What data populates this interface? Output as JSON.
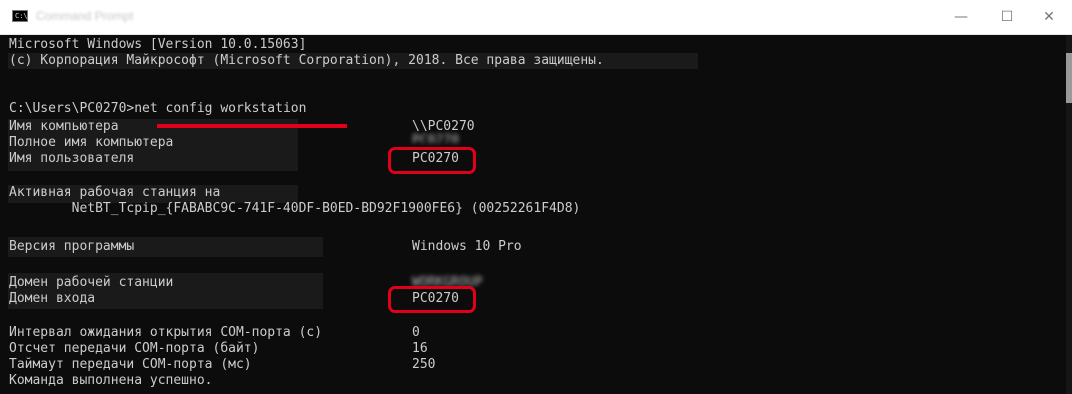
{
  "window": {
    "title": "Command Prompt",
    "icon_label": "C:\\",
    "minimize_glyph": "—",
    "maximize_glyph": "☐",
    "close_glyph": "✕"
  },
  "console": {
    "header_line1": "Microsoft Windows [Version 10.0.15063]",
    "header_line2": "(c) Корпорация Майкрософт (Microsoft Corporation), 2018. Все права защищены.",
    "prompt": "C:\\Users\\PC0270>",
    "command": "net config workstation",
    "rows": {
      "computer_name": {
        "label": "Имя компьютера",
        "value": "\\\\PC0270"
      },
      "full_computer_name": {
        "label": "Полное имя компьютера",
        "value": "PC0270"
      },
      "user_name": {
        "label": "Имя пользователя",
        "value": "PC0270"
      },
      "active_workstation": {
        "label": "Активная рабочая станция на"
      },
      "netbt_line": {
        "text": "        NetBT_Tcpip_{FABABC9C-741F-40DF-B0ED-BD92F1900FE6} (00252261F4D8)"
      },
      "software_version": {
        "label": "Версия программы",
        "value": "Windows 10 Pro"
      },
      "workstation_domain": {
        "label": "Домен рабочей станции",
        "value": "WORKGROUP"
      },
      "logon_domain": {
        "label": "Домен входа",
        "value": "PC0270"
      },
      "com_open_timeout": {
        "label": "Интервал ожидания открытия COM-порта (с)",
        "value": "0"
      },
      "com_send_count": {
        "label": "Отсчет передачи COM-порта (байт)",
        "value": "16"
      },
      "com_send_timeout": {
        "label": "Таймаут передачи COM-порта (мс)",
        "value": "250"
      },
      "completed": {
        "label": "Команда выполнена успешно."
      }
    }
  },
  "annotations": {
    "underline_color": "#e1001a",
    "box_color": "#e1001a"
  }
}
